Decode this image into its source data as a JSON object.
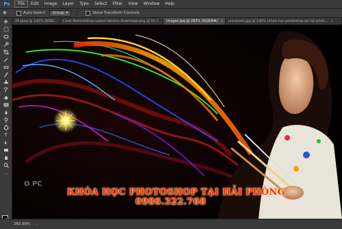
{
  "app": {
    "logo": "Ps"
  },
  "menu": [
    "File",
    "Edit",
    "Image",
    "Layer",
    "Type",
    "Select",
    "Filter",
    "View",
    "Window",
    "Help"
  ],
  "options": {
    "auto_select_label": "Auto-Select:",
    "auto_select_value": "Group",
    "transform_label": "Show Transform Controls"
  },
  "tabs": [
    {
      "label": "24.jpeg @ 100% (RGB/..."
    },
    {
      "label": "Corel-ParticleShop-Latest-Version-Download.png @ 66.7..."
    },
    {
      "label": "images.jpg @ 283% (RGB/8#)"
    },
    {
      "label": "unnamed.jpg @ 145% (khóa học photoshop tại hải phòn..."
    }
  ],
  "canvas": {
    "watermark": "O PC",
    "course_title": "KHÓA HỌC PHOTOSHOP TẠI HẢI PHÒNG",
    "phone": "0986.322.768"
  },
  "status": {
    "zoom": "282.99%",
    "arrow": "›"
  },
  "colors": {
    "overlay_text": "#ff2b0a",
    "menu_bg": "#3a3a3a",
    "canvas_bg": "#000000"
  }
}
